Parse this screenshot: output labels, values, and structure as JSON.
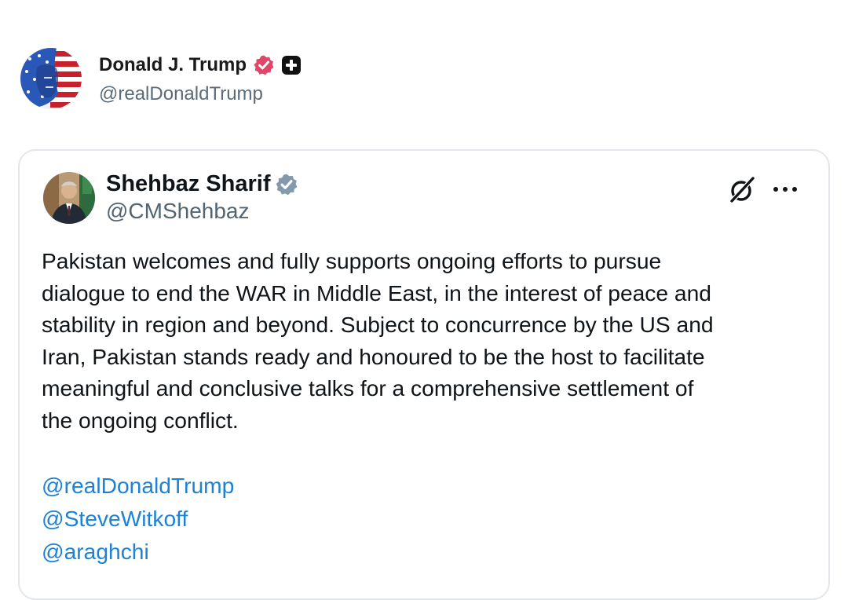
{
  "outer_post": {
    "display_name": "Donald J. Trump",
    "handle": "@realDonaldTrump",
    "verified_icon": "verified-badge-icon",
    "extra_icon": "plus-square-icon"
  },
  "quoted_post": {
    "display_name": "Shehbaz Sharif",
    "handle": "@CMShehbaz",
    "verified_icon": "verified-badge-icon",
    "grok_icon": "grok-icon",
    "more_icon": "more-options-icon",
    "body": "Pakistan welcomes and fully supports ongoing efforts to pursue\ndialogue to end the WAR in Middle East, in the interest of peace and\nstability in region and beyond. Subject to concurrence by the US and\nIran, Pakistan stands ready and honoured to be the host to facilitate\nmeaningful and conclusive talks for a comprehensive settlement of\nthe ongoing conflict.",
    "mentions": [
      "@realDonaldTrump",
      "@SteveWitkoff",
      "@araghchi"
    ]
  },
  "colors": {
    "mention_link": "#1d82d6",
    "outer_verified": "#e14567",
    "card_verified": "#829aab",
    "secondary_text": "#536471"
  }
}
